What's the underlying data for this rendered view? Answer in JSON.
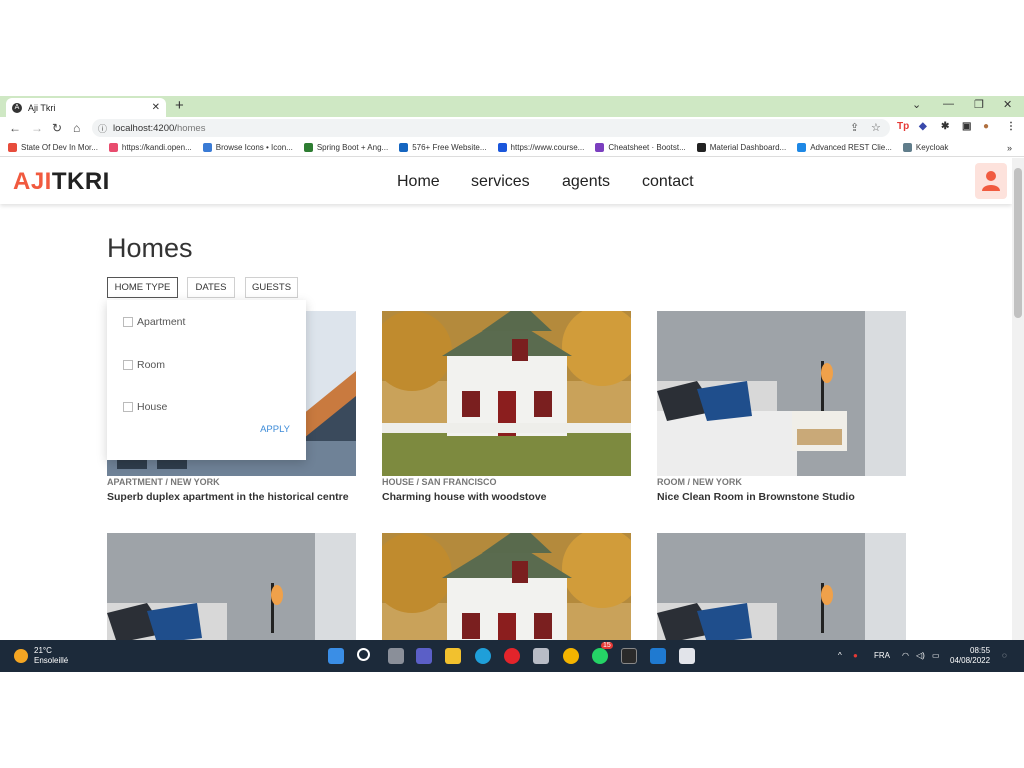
{
  "browser": {
    "tab_title": "Aji Tkri",
    "url_host": "localhost:4200/",
    "url_path": "homes",
    "bookmarks": [
      {
        "label": "State Of Dev In Mor...",
        "color": "#e74c3c"
      },
      {
        "label": "https://kandi.open...",
        "color": "#e84c6e"
      },
      {
        "label": "Browse Icons • Icon...",
        "color": "#3a7bd5"
      },
      {
        "label": "Spring Boot + Ang...",
        "color": "#2e7d32"
      },
      {
        "label": "576+ Free Website...",
        "color": "#1565c0"
      },
      {
        "label": "https://www.course...",
        "color": "#1a56db"
      },
      {
        "label": "Cheatsheet · Bootst...",
        "color": "#7b3fbf"
      },
      {
        "label": "Material Dashboard...",
        "color": "#222222"
      },
      {
        "label": "Advanced REST Clie...",
        "color": "#1e88e5"
      },
      {
        "label": "Keycloak",
        "color": "#607d8b"
      }
    ],
    "more_bookmarks": "»"
  },
  "app": {
    "logo_part1": "AJI",
    "logo_part2": "TKRI",
    "nav": [
      "Home",
      "services",
      "agents",
      "contact"
    ],
    "accent": "#f15a3f"
  },
  "main": {
    "heading": "Homes",
    "filters": [
      "HOME TYPE",
      "DATES",
      "GUESTS"
    ],
    "dropdown": {
      "options": [
        "Apartment",
        "Room",
        "House"
      ],
      "apply_label": "APPLY"
    },
    "cards": [
      {
        "meta": "APARTMENT / NEW YORK",
        "title": "Superb duplex apartment in the historical centre",
        "image": "apartment"
      },
      {
        "meta": "HOUSE / SAN FRANCISCO",
        "title": "Charming house with woodstove",
        "image": "house"
      },
      {
        "meta": "ROOM / NEW YORK",
        "title": "Nice Clean Room in Brownstone Studio",
        "image": "room"
      },
      {
        "meta": "",
        "title": "",
        "image": "room"
      },
      {
        "meta": "",
        "title": "",
        "image": "house"
      },
      {
        "meta": "",
        "title": "",
        "image": "room"
      }
    ]
  },
  "taskbar": {
    "temperature": "21°C",
    "weather": "Ensoleillé",
    "language": "FRA",
    "time": "08:55",
    "date": "04/08/2022",
    "whatsapp_badge": "15"
  }
}
